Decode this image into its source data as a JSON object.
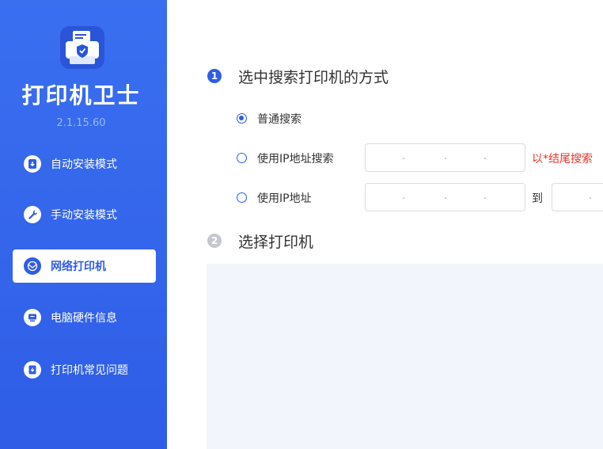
{
  "app": {
    "title": "打印机卫士",
    "version": "2.1.15.60"
  },
  "sidebar": {
    "items": [
      {
        "label": "自动安装模式",
        "icon": "download-circle-icon",
        "active": false
      },
      {
        "label": "手动安装模式",
        "icon": "wrench-icon",
        "active": false
      },
      {
        "label": "网络打印机",
        "icon": "network-globe-icon",
        "active": true
      },
      {
        "label": "电脑硬件信息",
        "icon": "monitor-icon",
        "active": false
      },
      {
        "label": "打印机常见问题",
        "icon": "faq-document-icon",
        "active": false
      }
    ]
  },
  "main": {
    "step1": {
      "number": "1",
      "title": "选中搜索打印机的方式"
    },
    "options": {
      "normal": {
        "label": "普通搜索",
        "checked": true
      },
      "ip_search": {
        "label": "使用IP地址搜索",
        "checked": false,
        "hint": "以*结尾搜索"
      },
      "ip_range": {
        "label": "使用IP地址",
        "checked": false,
        "to": "到"
      }
    },
    "ip_dot": ".",
    "step2": {
      "number": "2",
      "title": "选择打印机"
    }
  },
  "colors": {
    "brand": "#2f5de6",
    "hint": "#e8352c",
    "step_active": "#2f5de6",
    "step_inactive": "#c4c7cf"
  }
}
